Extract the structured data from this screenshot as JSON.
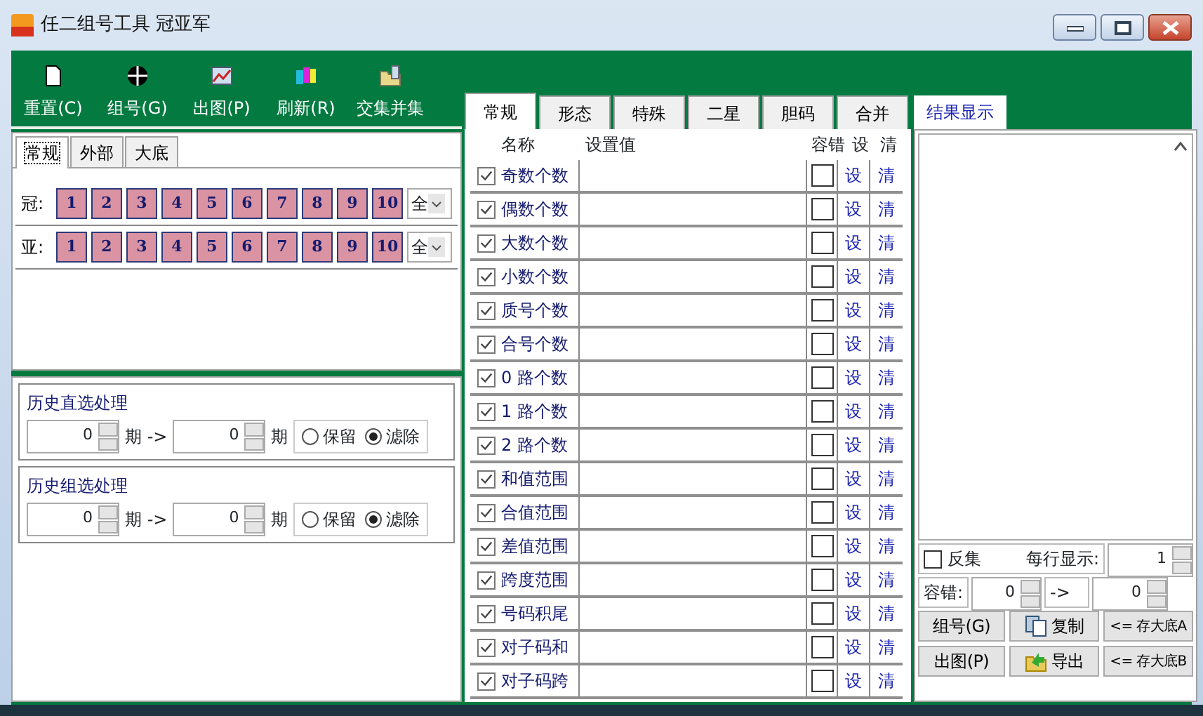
{
  "window": {
    "title": "任二组号工具 冠亚军"
  },
  "toolbar": [
    {
      "label": "重置(C)",
      "kind": "page"
    },
    {
      "label": "组号(G)",
      "kind": "target"
    },
    {
      "label": "出图(P)",
      "kind": "chart"
    },
    {
      "label": "刷新(R)",
      "kind": "books"
    },
    {
      "label": "交集并集",
      "kind": "folder"
    }
  ],
  "left_tabs": [
    {
      "label": "常规",
      "selected": true
    },
    {
      "label": "外部",
      "selected": false
    },
    {
      "label": "大底",
      "selected": false
    }
  ],
  "number_rows": [
    {
      "label": "冠:",
      "numbers": [
        "1",
        "2",
        "3",
        "4",
        "5",
        "6",
        "7",
        "8",
        "9",
        "10"
      ],
      "select": "全"
    },
    {
      "label": "亚:",
      "numbers": [
        "1",
        "2",
        "3",
        "4",
        "5",
        "6",
        "7",
        "8",
        "9",
        "10"
      ],
      "select": "全"
    }
  ],
  "history": [
    {
      "title": "历史直选处理",
      "from": "0",
      "unit_1": "期 ->",
      "to": "0",
      "unit_2": "期",
      "options": [
        {
          "label": "保留",
          "selected": false
        },
        {
          "label": "滤除",
          "selected": true
        }
      ]
    },
    {
      "title": "历史组选处理",
      "from": "0",
      "unit_1": "期 ->",
      "to": "0",
      "unit_2": "期",
      "options": [
        {
          "label": "保留",
          "selected": false
        },
        {
          "label": "滤除",
          "selected": true
        }
      ]
    }
  ],
  "middle_tabs": [
    {
      "label": "常规",
      "selected": true
    },
    {
      "label": "形态",
      "selected": false
    },
    {
      "label": "特殊",
      "selected": false
    },
    {
      "label": "二星",
      "selected": false
    },
    {
      "label": "胆码",
      "selected": false
    },
    {
      "label": "合并",
      "selected": false
    }
  ],
  "filter_table": {
    "columns": [
      "名称",
      "设置值",
      "容错",
      "设",
      "清"
    ],
    "rows": [
      {
        "name": "奇数个数",
        "checked": true,
        "tolerance": false,
        "set": "设",
        "clear": "清"
      },
      {
        "name": "偶数个数",
        "checked": true,
        "tolerance": false,
        "set": "设",
        "clear": "清"
      },
      {
        "name": "大数个数",
        "checked": true,
        "tolerance": false,
        "set": "设",
        "clear": "清"
      },
      {
        "name": "小数个数",
        "checked": true,
        "tolerance": false,
        "set": "设",
        "clear": "清"
      },
      {
        "name": "质号个数",
        "checked": true,
        "tolerance": false,
        "set": "设",
        "clear": "清"
      },
      {
        "name": "合号个数",
        "checked": true,
        "tolerance": false,
        "set": "设",
        "clear": "清"
      },
      {
        "name": "0 路个数",
        "checked": true,
        "tolerance": false,
        "set": "设",
        "clear": "清"
      },
      {
        "name": "1 路个数",
        "checked": true,
        "tolerance": false,
        "set": "设",
        "clear": "清"
      },
      {
        "name": "2 路个数",
        "checked": true,
        "tolerance": false,
        "set": "设",
        "clear": "清"
      },
      {
        "name": "和值范围",
        "checked": true,
        "tolerance": false,
        "set": "设",
        "clear": "清"
      },
      {
        "name": "合值范围",
        "checked": true,
        "tolerance": false,
        "set": "设",
        "clear": "清"
      },
      {
        "name": "差值范围",
        "checked": true,
        "tolerance": false,
        "set": "设",
        "clear": "清"
      },
      {
        "name": "跨度范围",
        "checked": true,
        "tolerance": false,
        "set": "设",
        "clear": "清"
      },
      {
        "name": "号码积尾",
        "checked": true,
        "tolerance": false,
        "set": "设",
        "clear": "清"
      },
      {
        "name": "对子码和",
        "checked": true,
        "tolerance": false,
        "set": "设",
        "clear": "清"
      },
      {
        "name": "对子码跨",
        "checked": true,
        "tolerance": false,
        "set": "设",
        "clear": "清"
      }
    ]
  },
  "results": {
    "tab": {
      "label": "结果显示",
      "selected": true
    },
    "invert": {
      "label": "反集",
      "checked": false
    },
    "per_row_label": "每行显示:",
    "per_row": "1",
    "tolerance_label": "容错:",
    "tolerance_from": "0",
    "arrow": "->",
    "tolerance_to": "0",
    "buttons": [
      {
        "label": "组号(G)",
        "kind": "plain"
      },
      {
        "label": "复制",
        "kind": "copy"
      },
      {
        "label": "<= 存大底A",
        "kind": "plain"
      },
      {
        "label": "出图(P)",
        "kind": "plain"
      },
      {
        "label": "导出",
        "kind": "export"
      },
      {
        "label": "<= 存大底B",
        "kind": "plain"
      }
    ]
  }
}
